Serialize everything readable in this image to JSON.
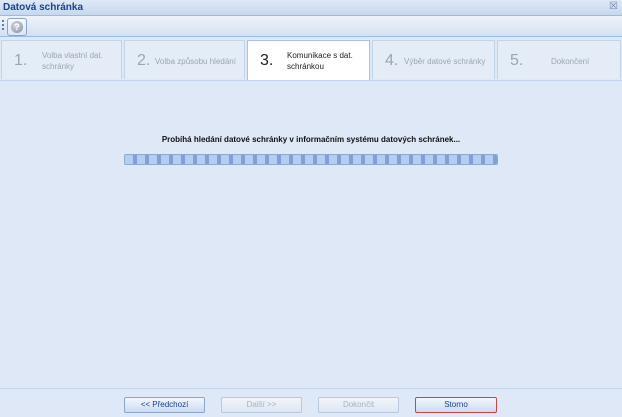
{
  "window": {
    "title": "Datová schránka",
    "close_glyph": "☒"
  },
  "toolbar": {
    "help_icon": "question-icon",
    "help_glyph": "?"
  },
  "steps": [
    {
      "num": "1.",
      "label": "Volba vlastní dat. schránky"
    },
    {
      "num": "2.",
      "label": "Volba způsobu hledání"
    },
    {
      "num": "3.",
      "label": "Komunikace s dat. schránkou"
    },
    {
      "num": "4.",
      "label": "Výběr datové schránky"
    },
    {
      "num": "5.",
      "label": "Dokončení"
    }
  ],
  "main": {
    "message": "Probíhá hledání datové schránky v informačním systému datových schránek...",
    "progress": 1.0
  },
  "buttons": {
    "previous": "<< Předchozí",
    "next": "Další >>",
    "finish": "Dokončit",
    "cancel": "Storno"
  }
}
